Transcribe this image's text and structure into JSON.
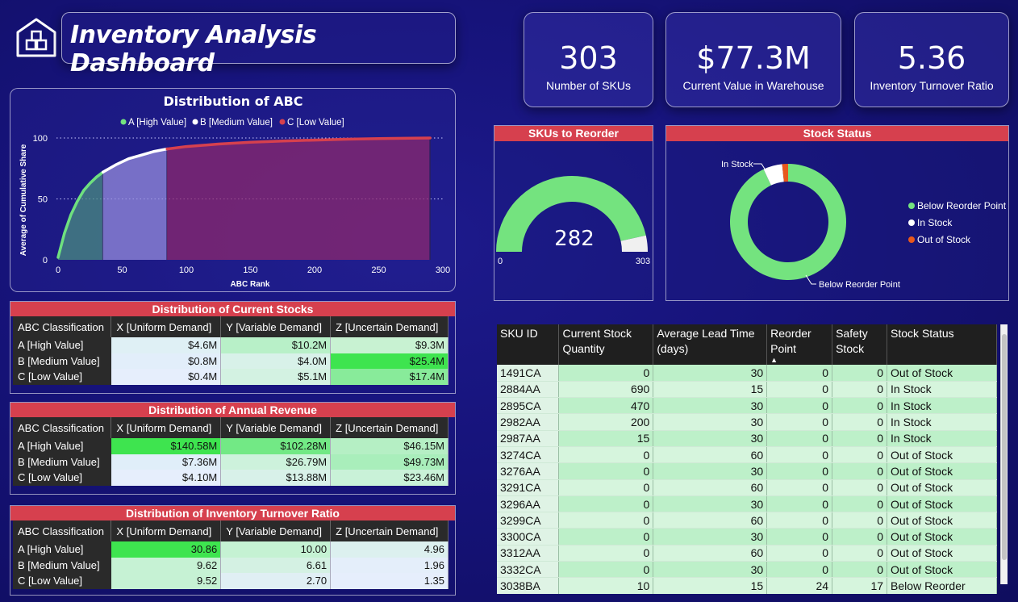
{
  "header": {
    "title": "Inventory Analysis Dashboard",
    "logo_icon": "warehouse-boxes-icon"
  },
  "kpis": [
    {
      "value": "303",
      "label": "Number of SKUs"
    },
    {
      "value": "$77.3M",
      "label": "Current Value in Warehouse"
    },
    {
      "value": "5.36",
      "label": "Inventory Turnover Ratio"
    }
  ],
  "abc_chart": {
    "title": "Distribution of ABC",
    "legend": [
      "A [High Value]",
      "B [Medium Value]",
      "C [Low Value]"
    ],
    "ylabel": "Average of Cumulative Share",
    "xlabel": "ABC Rank",
    "xticks": [
      "0",
      "50",
      "100",
      "150",
      "200",
      "250",
      "300"
    ],
    "yticks": [
      "0",
      "50",
      "100"
    ]
  },
  "chart_data": {
    "type": "area",
    "title": "Distribution of ABC",
    "xlabel": "ABC Rank",
    "ylabel": "Average of Cumulative Share",
    "xlim": [
      0,
      300
    ],
    "ylim": [
      0,
      100
    ],
    "series": [
      {
        "name": "A [High Value]",
        "color": "#6fe07f",
        "x": [
          0,
          5,
          10,
          15,
          20,
          25,
          30,
          35
        ],
        "y": [
          2,
          22,
          37,
          48,
          57,
          63,
          68,
          72
        ]
      },
      {
        "name": "B [Medium Value]",
        "color": "#ffffff",
        "x": [
          35,
          45,
          55,
          65,
          75,
          85
        ],
        "y": [
          72,
          78,
          83,
          86,
          89,
          91
        ]
      },
      {
        "name": "C [Low Value]",
        "color": "#d6404e",
        "x": [
          85,
          100,
          125,
          150,
          175,
          200,
          225,
          250,
          275,
          290
        ],
        "y": [
          91,
          93,
          95,
          96.5,
          97.5,
          98.3,
          99,
          99.5,
          99.8,
          100
        ]
      }
    ],
    "grid": true,
    "legend_position": "top-center"
  },
  "stocks_table": {
    "title": "Distribution of Current Stocks",
    "columns": [
      "ABC Classification",
      "X [Uniform Demand]",
      "Y [Variable Demand]",
      "Z [Uncertain Demand]"
    ],
    "rows": [
      {
        "label": "A [High Value]",
        "values": [
          "$4.6M",
          "$10.2M",
          "$9.3M"
        ],
        "colors": [
          "#dff0f5",
          "#b8f0c8",
          "#c8f2d2"
        ]
      },
      {
        "label": "B [Medium Value]",
        "values": [
          "$0.8M",
          "$4.0M",
          "$25.4M"
        ],
        "colors": [
          "#e2eefa",
          "#d8f1e9",
          "#3ee44f"
        ]
      },
      {
        "label": "C [Low Value]",
        "values": [
          "$0.4M",
          "$5.1M",
          "$17.4M"
        ],
        "colors": [
          "#e6eefc",
          "#d3f2e2",
          "#88eb9a"
        ]
      }
    ]
  },
  "revenue_table": {
    "title": "Distribution of Annual Revenue",
    "columns": [
      "ABC Classification",
      "X [Uniform Demand]",
      "Y [Variable Demand]",
      "Z [Uncertain Demand]"
    ],
    "rows": [
      {
        "label": "A [High Value]",
        "values": [
          "$140.58M",
          "$102.28M",
          "$46.15M"
        ],
        "colors": [
          "#3ee44f",
          "#72e985",
          "#b5efc4"
        ]
      },
      {
        "label": "B [Medium Value]",
        "values": [
          "$7.36M",
          "$26.79M",
          "$49.73M"
        ],
        "colors": [
          "#e0eef9",
          "#cdf2dc",
          "#a9eebb"
        ]
      },
      {
        "label": "C [Low Value]",
        "values": [
          "$4.10M",
          "$13.88M",
          "$23.46M"
        ],
        "colors": [
          "#e6eefc",
          "#d8f1e9",
          "#c9f2d8"
        ]
      }
    ]
  },
  "turnover_table": {
    "title": "Distribution of Inventory Turnover Ratio",
    "columns": [
      "ABC Classification",
      "X [Uniform Demand]",
      "Y [Variable Demand]",
      "Z [Uncertain Demand]"
    ],
    "rows": [
      {
        "label": "A [High Value]",
        "values": [
          "30.86",
          "10.00",
          "4.96"
        ],
        "colors": [
          "#3ee44f",
          "#c5f2d3",
          "#dcf0ef"
        ]
      },
      {
        "label": "B [Medium Value]",
        "values": [
          "9.62",
          "6.61",
          "1.96"
        ],
        "colors": [
          "#c6f2d4",
          "#d4f1e3",
          "#e4eefa"
        ]
      },
      {
        "label": "C [Low Value]",
        "values": [
          "9.52",
          "2.70",
          "1.35"
        ],
        "colors": [
          "#c6f2d4",
          "#e0eff4",
          "#e6eefc"
        ]
      }
    ]
  },
  "reorder_gauge": {
    "title": "SKUs to Reorder",
    "value": "282",
    "min": "0",
    "max": "303",
    "fraction": 0.9307,
    "fill_color": "#74e37f",
    "rest_color": "#f0f0f0"
  },
  "stock_status": {
    "title": "Stock Status",
    "legend": [
      "Below Reorder Point",
      "In Stock",
      "Out of Stock"
    ],
    "colors": [
      "#74e37f",
      "#ffffff",
      "#e8581c"
    ],
    "fractions": [
      0.9307,
      0.0528,
      0.0165
    ],
    "callout_in_stock": "In Stock",
    "callout_below": "Below Reorder Point"
  },
  "sku_table": {
    "columns": [
      "SKU ID",
      "Current Stock Quantity",
      "Average Lead Time (days)",
      "Reorder Point",
      "Safety Stock",
      "Stock Status"
    ],
    "rows": [
      [
        "1491CA",
        "0",
        "30",
        "0",
        "0",
        "Out of Stock"
      ],
      [
        "2884AA",
        "690",
        "15",
        "0",
        "0",
        "In Stock"
      ],
      [
        "2895CA",
        "470",
        "30",
        "0",
        "0",
        "In Stock"
      ],
      [
        "2982AA",
        "200",
        "30",
        "0",
        "0",
        "In Stock"
      ],
      [
        "2987AA",
        "15",
        "30",
        "0",
        "0",
        "In Stock"
      ],
      [
        "3274CA",
        "0",
        "60",
        "0",
        "0",
        "Out of Stock"
      ],
      [
        "3276AA",
        "0",
        "30",
        "0",
        "0",
        "Out of Stock"
      ],
      [
        "3291CA",
        "0",
        "60",
        "0",
        "0",
        "Out of Stock"
      ],
      [
        "3296AA",
        "0",
        "30",
        "0",
        "0",
        "Out of Stock"
      ],
      [
        "3299CA",
        "0",
        "60",
        "0",
        "0",
        "Out of Stock"
      ],
      [
        "3300CA",
        "0",
        "30",
        "0",
        "0",
        "Out of Stock"
      ],
      [
        "3312AA",
        "0",
        "60",
        "0",
        "0",
        "Out of Stock"
      ],
      [
        "3332CA",
        "0",
        "30",
        "0",
        "0",
        "Out of Stock"
      ],
      [
        "3038BA",
        "10",
        "15",
        "24",
        "17",
        "Below Reorder"
      ]
    ]
  }
}
